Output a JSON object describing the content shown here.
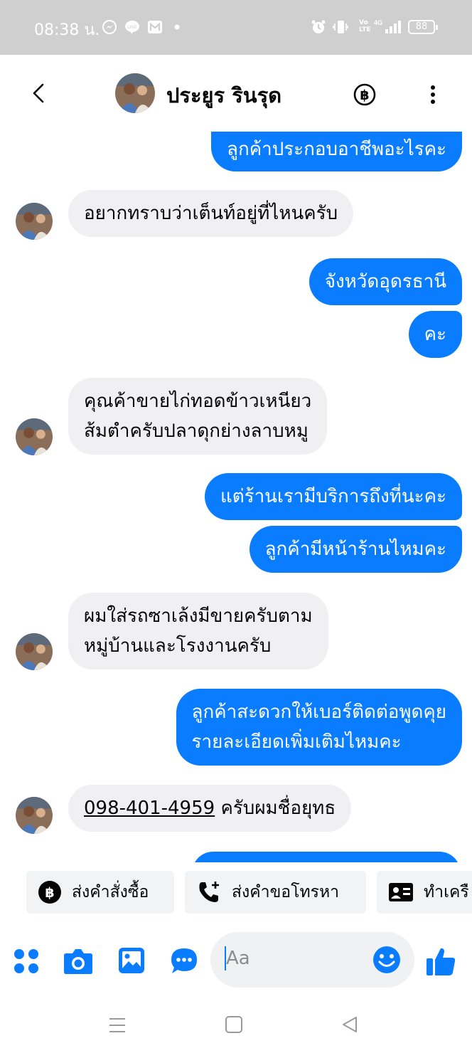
{
  "status_bar": {
    "time": "08:38 น.",
    "volte": "Vo LTE",
    "network": "4G",
    "battery": "88"
  },
  "header": {
    "contact_name": "ประยูร รินรุด",
    "icons": [
      "back-arrow-icon",
      "avatar",
      "baht-icon",
      "more-vert-icon"
    ]
  },
  "messages": [
    {
      "from": "me",
      "text": "ลูกค้าประกอบอาชีพอะไรคะ"
    },
    {
      "from": "them",
      "text": "อยากทราบว่าเต็นท์อยู่ที่ไหนครับ"
    },
    {
      "from": "me",
      "text": "จังหวัดอุดรธานี"
    },
    {
      "from": "me",
      "text": "คะ"
    },
    {
      "from": "them",
      "text": "คุณค้าขายไก่ทอดข้าวเหนียว\nส้มตำครับปลาดุกย่างลาบหมู"
    },
    {
      "from": "me",
      "text": "แต่ร้านเรามีบริการถึงที่นะคะ"
    },
    {
      "from": "me",
      "text": "ลูกค้ามีหน้าร้านไหมคะ"
    },
    {
      "from": "them",
      "text": "ผมใส่รถซาเล้งมีขายครับตาม\nหมู่บ้านและโรงงานครับ"
    },
    {
      "from": "me",
      "text": "ลูกค้าสะดวกให้เบอร์ติดต่อพูดคุย\nรายละเอียดเพิ่มเติมไหมคะ"
    },
    {
      "from": "them",
      "phone": "098-401-4959",
      "text": " ครับผมชื่อยุทธ"
    }
  ],
  "quick_actions": [
    {
      "label": "ส่งคำสั่งซื้อ",
      "icon": "baht-circle-icon"
    },
    {
      "label": "ส่งคำขอโทรหา",
      "icon": "phone-plus-icon"
    },
    {
      "label": "ทำเครื",
      "icon": "id-card-icon"
    }
  ],
  "composer": {
    "placeholder": "Aa",
    "icons": [
      "apps-icon",
      "camera-icon",
      "gallery-icon",
      "chat-bubble-icon",
      "emoji-icon",
      "like-icon"
    ]
  },
  "colors": {
    "accent": "#0A7CFF",
    "incoming_bubble": "#F0F0F2",
    "status_bar": "#CFCFCF"
  }
}
